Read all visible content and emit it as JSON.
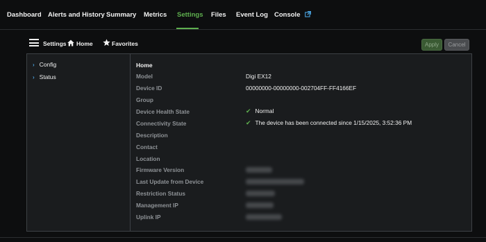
{
  "nav": {
    "items": [
      {
        "label": "Dashboard"
      },
      {
        "label": "Alerts and History"
      },
      {
        "label": "Summary"
      },
      {
        "label": "Metrics"
      },
      {
        "label": "Settings",
        "active": true
      },
      {
        "label": "Files"
      },
      {
        "label": "Event Log"
      },
      {
        "label": "Console",
        "icon": "external-link-icon"
      }
    ],
    "accent_color": "#5fb04f"
  },
  "toolbar": {
    "settings_label": "Settings",
    "home_label": "Home",
    "favorites_label": "Favorites",
    "apply_label": "Apply",
    "cancel_label": "Cancel"
  },
  "sidebar": {
    "items": [
      {
        "label": "Config"
      },
      {
        "label": "Status"
      }
    ]
  },
  "content": {
    "title": "Home",
    "rows": [
      {
        "label": "Model",
        "value": "Digi EX12"
      },
      {
        "label": "Device ID",
        "value": "00000000-00000000-002704FF-FF4166EF"
      },
      {
        "label": "Group",
        "value": ""
      },
      {
        "label": "Device Health State",
        "value": "Normal",
        "status": "ok"
      },
      {
        "label": "Connectivity State",
        "value": "The device has been connected since 1/15/2025, 3:52:36 PM",
        "status": "ok"
      },
      {
        "label": "Description",
        "value": ""
      },
      {
        "label": "Contact",
        "value": ""
      },
      {
        "label": "Location",
        "value": ""
      },
      {
        "label": "Firmware Version",
        "value": "",
        "redacted": true
      },
      {
        "label": "Last Update from Device",
        "value": "",
        "redacted": true
      },
      {
        "label": "Restriction Status",
        "value": "",
        "redacted": true
      },
      {
        "label": "Management IP",
        "value": "",
        "redacted": true
      },
      {
        "label": "Uplink IP",
        "value": "",
        "redacted": true
      }
    ]
  }
}
